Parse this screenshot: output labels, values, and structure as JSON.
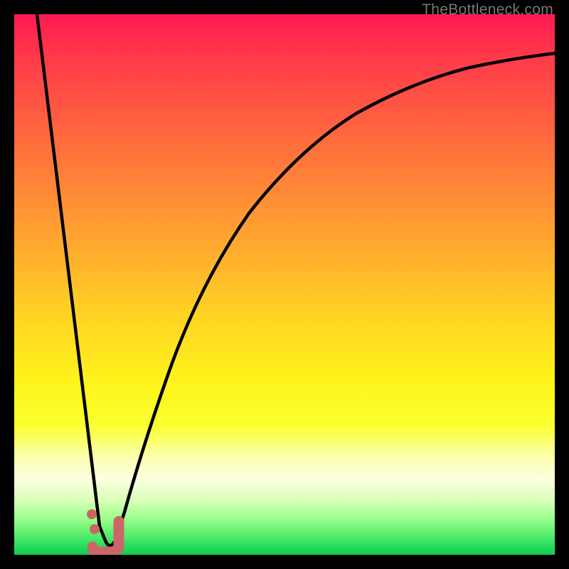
{
  "watermark": "TheBottleneck.com",
  "colors": {
    "frame": "#000000",
    "curve_stroke": "#000000",
    "marker_stroke": "#cc6666",
    "marker_fill": "#cc6666"
  },
  "chart_data": {
    "type": "line",
    "title": "",
    "xlabel": "",
    "ylabel": "",
    "xlim": [
      0,
      100
    ],
    "ylim": [
      0,
      100
    ],
    "background": "heatmap-gradient red-to-green",
    "x": [
      0,
      5,
      10,
      12,
      14,
      15,
      16,
      17,
      18,
      20,
      22,
      25,
      30,
      35,
      40,
      50,
      60,
      70,
      80,
      90,
      100
    ],
    "series": [
      {
        "name": "bottleneck-curve",
        "values": [
          100,
          70,
          40,
          27,
          15,
          8,
          3,
          0,
          2,
          10,
          21,
          35,
          52,
          63,
          71,
          81,
          86,
          89,
          91,
          92,
          93
        ]
      }
    ],
    "markers": [
      {
        "shape": "j-curve",
        "x": 17,
        "y": 1.5,
        "width": 3.5,
        "height": 5
      },
      {
        "shape": "dot",
        "x": 14.2,
        "y": 7
      },
      {
        "shape": "dot",
        "x": 14.8,
        "y": 4.3
      }
    ],
    "annotations": []
  }
}
